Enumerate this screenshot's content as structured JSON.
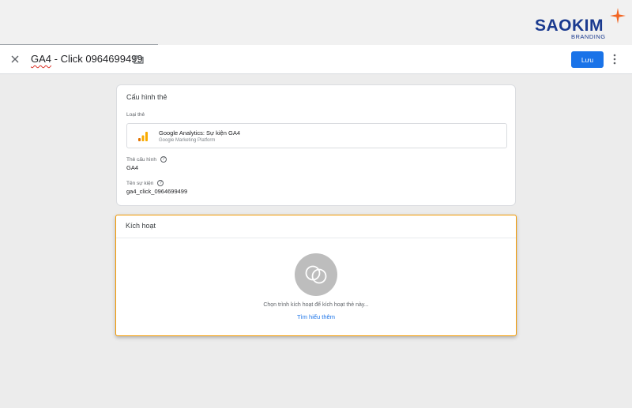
{
  "brand": {
    "name": "SAOKIM",
    "tagline": "BRANDING"
  },
  "header": {
    "title_prefix": "GA4",
    "title_rest": " - Click 0964699499",
    "save_label": "Lưu",
    "close_icon": "close-icon",
    "folder_icon": "folder-icon",
    "more_icon": "more-vert-icon"
  },
  "config": {
    "title": "Cấu hình thẻ",
    "tag_type_label": "Loại thẻ",
    "tag_type_name": "Google Analytics: Sự kiện GA4",
    "tag_type_sub": "Google Marketing Platform",
    "config_tag_label": "Thẻ cấu hình",
    "config_tag_value": "GA4",
    "event_name_label": "Tên sự kiện",
    "event_name_value": "ga4_click_0964699499"
  },
  "trigger": {
    "title": "Kích hoạt",
    "hint": "Chọn trình kích hoạt để kích hoạt thẻ này...",
    "learn_more": "Tìm hiểu thêm"
  },
  "colors": {
    "accent": "#1a73e8",
    "ga_orange": "#f9ab00",
    "trigger_border": "#f29900",
    "brand_blue": "#1a3a8f",
    "brand_star": "#f26522"
  }
}
